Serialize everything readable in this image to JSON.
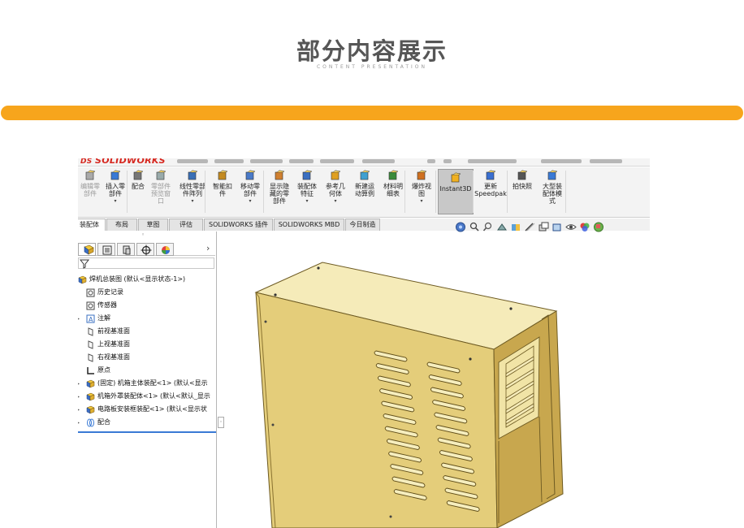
{
  "header": {
    "title": "部分内容展示",
    "subtitle": "CONTENT PRESENTATION"
  },
  "app": {
    "logo_text": "SOLIDWORKS",
    "ribbon": [
      {
        "id": "edit-component",
        "label": "编辑零\n部件",
        "icon": "edit-component-icon",
        "dim": true
      },
      {
        "id": "insert-component",
        "label": "插入零\n部件",
        "icon": "insert-component-icon",
        "arrow": true
      },
      {
        "id": "mate",
        "label": "配合",
        "icon": "mate-icon"
      },
      {
        "id": "component-preview",
        "label": "零部件\n预览窗\n口",
        "icon": "component-preview-icon",
        "dim": true
      },
      {
        "id": "linear-pattern",
        "label": "线性零部\n件阵列",
        "icon": "linear-pattern-icon",
        "arrow": true
      },
      {
        "id": "smart-fasteners",
        "label": "智能扣\n件",
        "icon": "smart-fasteners-icon"
      },
      {
        "id": "move-component",
        "label": "移动零\n部件",
        "icon": "move-component-icon",
        "arrow": true
      },
      {
        "id": "show-hidden",
        "label": "显示隐\n藏的零\n部件",
        "icon": "show-hidden-icon"
      },
      {
        "id": "assembly-features",
        "label": "装配体\n特征",
        "icon": "assembly-features-icon",
        "arrow": true
      },
      {
        "id": "reference-geometry",
        "label": "参考几\n何体",
        "icon": "reference-geometry-icon",
        "arrow": true
      },
      {
        "id": "new-motion-study",
        "label": "新建运\n动算例",
        "icon": "motion-study-icon"
      },
      {
        "id": "bill-of-materials",
        "label": "材料明\n细表",
        "icon": "bom-icon"
      },
      {
        "id": "exploded-view",
        "label": "爆炸视\n图",
        "icon": "exploded-view-icon",
        "arrow": true
      },
      {
        "id": "instant3d",
        "label": "Instant3D",
        "icon": "instant3d-icon",
        "active": true
      },
      {
        "id": "update-speedpak",
        "label": "更新\nSpeedpak",
        "icon": "speedpak-icon"
      },
      {
        "id": "snapshot",
        "label": "拍快照",
        "icon": "camera-icon"
      },
      {
        "id": "large-assembly",
        "label": "大型装\n配体模\n式",
        "icon": "large-assembly-icon"
      }
    ],
    "tabs": [
      {
        "label": "装配体",
        "active": true
      },
      {
        "label": "布局"
      },
      {
        "label": "草图"
      },
      {
        "label": "评估"
      },
      {
        "label": "SOLIDWORKS 插件"
      },
      {
        "label": "SOLIDWORKS MBD"
      },
      {
        "label": "今日制造"
      }
    ],
    "tree": [
      {
        "label": "焊机总装图 (默认<显示状态-1>)",
        "icon": "assembly-icon",
        "level": 0
      },
      {
        "label": "历史记录",
        "icon": "history-icon",
        "level": 1
      },
      {
        "label": "传感器",
        "icon": "sensor-icon",
        "level": 1
      },
      {
        "label": "注解",
        "icon": "annotation-icon",
        "level": 1,
        "expander": true
      },
      {
        "label": "前视基准面",
        "icon": "plane-icon",
        "level": 1
      },
      {
        "label": "上视基准面",
        "icon": "plane-icon",
        "level": 1
      },
      {
        "label": "右视基准面",
        "icon": "plane-icon",
        "level": 1
      },
      {
        "label": "原点",
        "icon": "origin-icon",
        "level": 1
      },
      {
        "label": "(固定) 机箱主体装配<1> (默认<显示",
        "icon": "subassembly-icon",
        "level": 1,
        "expander": true
      },
      {
        "label": "机箱外罩装配体<1> (默认<默认_显示",
        "icon": "subassembly-icon",
        "level": 1,
        "expander": true
      },
      {
        "label": "电路板安装框装配<1> (默认<显示状",
        "icon": "subassembly-icon",
        "level": 1,
        "expander": true
      },
      {
        "label": "配合",
        "icon": "mates-icon",
        "level": 1,
        "expander": true
      }
    ]
  },
  "colors": {
    "accent_bar": "#f7a51c",
    "title": "#565656",
    "model_face_top": "#f5eab5",
    "model_face_front": "#dfc672",
    "model_face_side": "#c9a84f"
  }
}
